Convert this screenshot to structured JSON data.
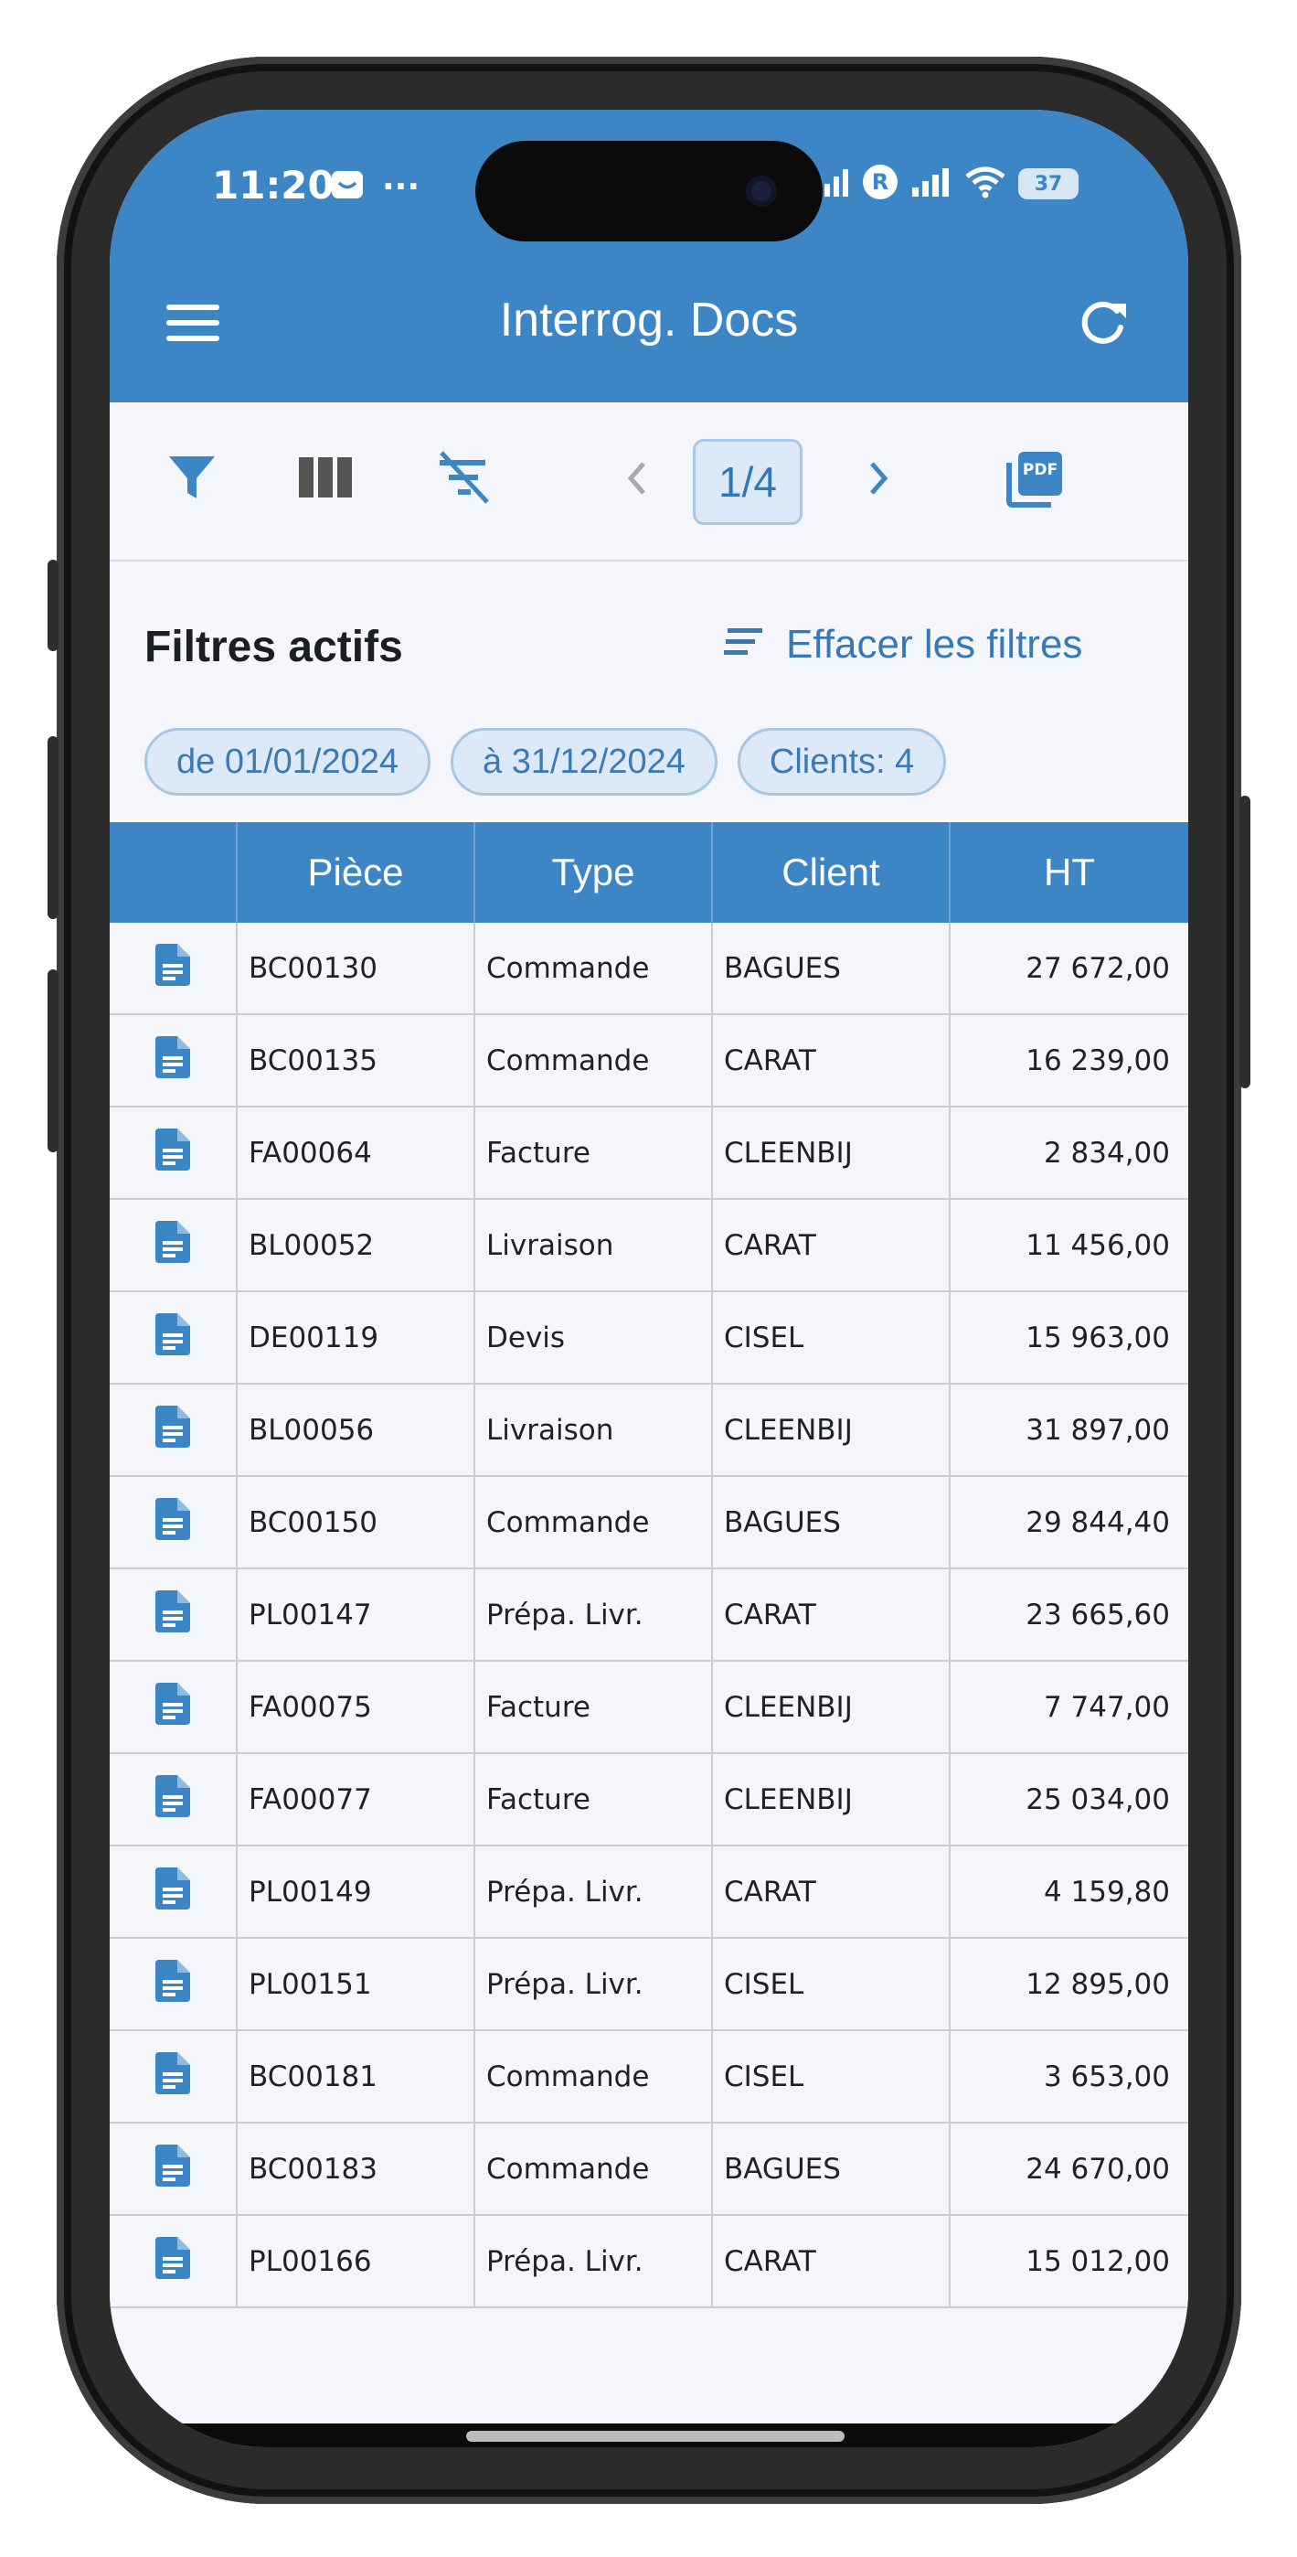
{
  "status_bar": {
    "time": "11:20",
    "dots": "···",
    "battery": "37",
    "icons": [
      "mail-icon",
      "signal-icon",
      "r-badge-icon",
      "wifi-icon",
      "battery-icon"
    ]
  },
  "header": {
    "title": "Interrog. Docs",
    "menu_icon": "hamburger-icon",
    "refresh_icon": "refresh-icon"
  },
  "toolbar": {
    "filter_icon": "filter-icon",
    "columns_icon": "columns-icon",
    "clear_filter_icon": "filter-off-icon",
    "page_label": "1/4",
    "pdf_label": "PDF"
  },
  "filters": {
    "title": "Filtres actifs",
    "clear_label": "Effacer les filtres",
    "chips": [
      "de 01/01/2024",
      "à 31/12/2024",
      "Clients: 4"
    ]
  },
  "table": {
    "columns": [
      "",
      "Pièce",
      "Type",
      "Client",
      "HT"
    ],
    "rows": [
      [
        "BC00130",
        "Commande",
        "BAGUES",
        "27 672,00"
      ],
      [
        "BC00135",
        "Commande",
        "CARAT",
        "16 239,00"
      ],
      [
        "FA00064",
        "Facture",
        "CLEENBIJ",
        "2 834,00"
      ],
      [
        "BL00052",
        "Livraison",
        "CARAT",
        "11 456,00"
      ],
      [
        "DE00119",
        "Devis",
        "CISEL",
        "15 963,00"
      ],
      [
        "BL00056",
        "Livraison",
        "CLEENBIJ",
        "31 897,00"
      ],
      [
        "BC00150",
        "Commande",
        "BAGUES",
        "29 844,40"
      ],
      [
        "PL00147",
        "Prépa. Livr.",
        "CARAT",
        "23 665,60"
      ],
      [
        "FA00075",
        "Facture",
        "CLEENBIJ",
        "7 747,00"
      ],
      [
        "FA00077",
        "Facture",
        "CLEENBIJ",
        "25 034,00"
      ],
      [
        "PL00149",
        "Prépa. Livr.",
        "CARAT",
        "4 159,80"
      ],
      [
        "PL00151",
        "Prépa. Livr.",
        "CISEL",
        "12 895,00"
      ],
      [
        "BC00181",
        "Commande",
        "CISEL",
        "3 653,00"
      ],
      [
        "BC00183",
        "Commande",
        "BAGUES",
        "24 670,00"
      ],
      [
        "PL00166",
        "Prépa. Livr.",
        "CARAT",
        "15 012,00"
      ]
    ]
  },
  "colors": {
    "primary": "#3d86c6",
    "background": "#f4f6fb",
    "chip_bg": "#dde9f6"
  }
}
